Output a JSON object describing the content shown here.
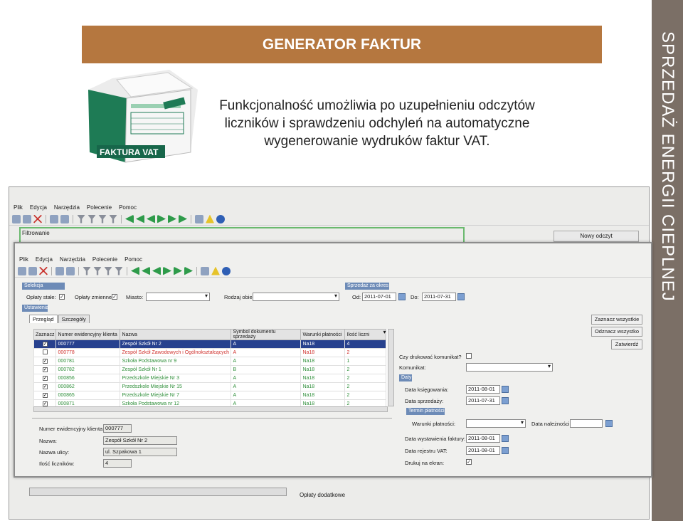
{
  "slide": {
    "header_title": "GENERATOR FAKTUR",
    "description": "Funkcjonalność umożliwia po uzupełnieniu odczytów liczników i sprawdzeniu odchyleń na automatyczne wygenerowanie wydruków faktur VAT.",
    "side_title": "SPRZEDAŻ ENERGII CIEPLNEJ",
    "image_caption_big": "FAKTURA VAT",
    "colors": {
      "header": "#b5773f",
      "side_band": "#7b6f66",
      "selection": "#27418e",
      "red_row": "#d0312d",
      "green_row": "#2f8f3a"
    }
  },
  "back_window": {
    "menu": [
      "Plik",
      "Edycja",
      "Narzędzia",
      "Polecenie",
      "Pomoc"
    ],
    "filter_label": "Filtrowanie",
    "new_reading_button": "Nowy odczyt",
    "extra_fees_label": "Opłaty dodatkowe"
  },
  "front_window": {
    "menu": [
      "Plik",
      "Edycja",
      "Narzędzia",
      "Polecenie",
      "Pomoc"
    ],
    "selection_strip": "Selekcja",
    "period_strip": "Sprzedaż za okres",
    "fixed_fees_label": "Opłaty stałe:",
    "variable_fees_label": "Opłaty zmienne:",
    "city_label": "Miasto:",
    "object_type_label": "Rodzaj obiektu:",
    "from_label": "Od:",
    "from_value": "2011-07-01",
    "to_label": "Do:",
    "to_value": "2011-07-31",
    "settings_strip": "Ustawienia",
    "tabs": [
      "Przegląd",
      "Szczegóły"
    ],
    "columns": [
      "Zaznacz",
      "Numer ewidencyjny klienta",
      "Nazwa",
      "Symbol dokumentu sprzedaży",
      "Warunki płatności",
      "Ilość liczni"
    ],
    "rows": [
      {
        "check": "✓",
        "num": "000777",
        "name": "Zespół Szkół Nr 2",
        "symbol": "A",
        "terms": "Na18",
        "count": "4",
        "style": "sel"
      },
      {
        "check": "",
        "num": "000778",
        "name": "Zespół Szkół Zawodowych i Ogólnokształcących",
        "symbol": "A",
        "terms": "Na18",
        "count": "2",
        "style": "red"
      },
      {
        "check": "✓",
        "num": "000781",
        "name": "Szkoła Podstawowa nr 9",
        "symbol": "A",
        "terms": "Na18",
        "count": "1",
        "style": "green"
      },
      {
        "check": "✓",
        "num": "000782",
        "name": "Zespół Szkół Nr 1",
        "symbol": "B",
        "terms": "Na18",
        "count": "2",
        "style": "green"
      },
      {
        "check": "✓",
        "num": "000856",
        "name": "Przedszkole Miejskie Nr 3",
        "symbol": "A",
        "terms": "Na18",
        "count": "2",
        "style": "green"
      },
      {
        "check": "✓",
        "num": "000862",
        "name": "Przedszkole Miejskie Nr 15",
        "symbol": "A",
        "terms": "Na18",
        "count": "2",
        "style": "green"
      },
      {
        "check": "✓",
        "num": "000865",
        "name": "Przedszkole Miejskie Nr 7",
        "symbol": "A",
        "terms": "Na18",
        "count": "2",
        "style": "green"
      },
      {
        "check": "✓",
        "num": "000871",
        "name": "Szkoła Podstawowa nr 12",
        "symbol": "A",
        "terms": "Na18",
        "count": "2",
        "style": "green"
      }
    ],
    "select_all": "Zaznacz wszystkie",
    "deselect_all": "Odznacz wszystko",
    "confirm": "Zatwierdź",
    "print_message_label": "Czy drukować komunikat?",
    "message_label": "Komunikat:",
    "dates_strip": "Daty",
    "booking_date_label": "Data księgowania:",
    "booking_date_value": "2011-08-01",
    "sale_date_label": "Data sprzedaży:",
    "sale_date_value": "2011-07-31",
    "payment_strip": "Termin płatności",
    "payment_terms_label": "Warunki płatności:",
    "due_date_label": "Data należności:",
    "invoice_date_label": "Data wystawienia faktury:",
    "invoice_date_value": "2011-08-01",
    "vat_reg_label": "Data rejestru VAT:",
    "vat_reg_value": "2011-08-01",
    "print_screen_label": "Drukuj na ekran:",
    "detail": {
      "client_num_label": "Numer ewidencyjny klienta:",
      "client_num_value": "000777",
      "name_label": "Nazwa:",
      "name_value": "Zespół Szkół Nr 2",
      "street_label": "Nazwa ulicy:",
      "street_value": "ul. Szpakowa 1",
      "meters_label": "Ilość liczników:",
      "meters_value": "4"
    }
  }
}
